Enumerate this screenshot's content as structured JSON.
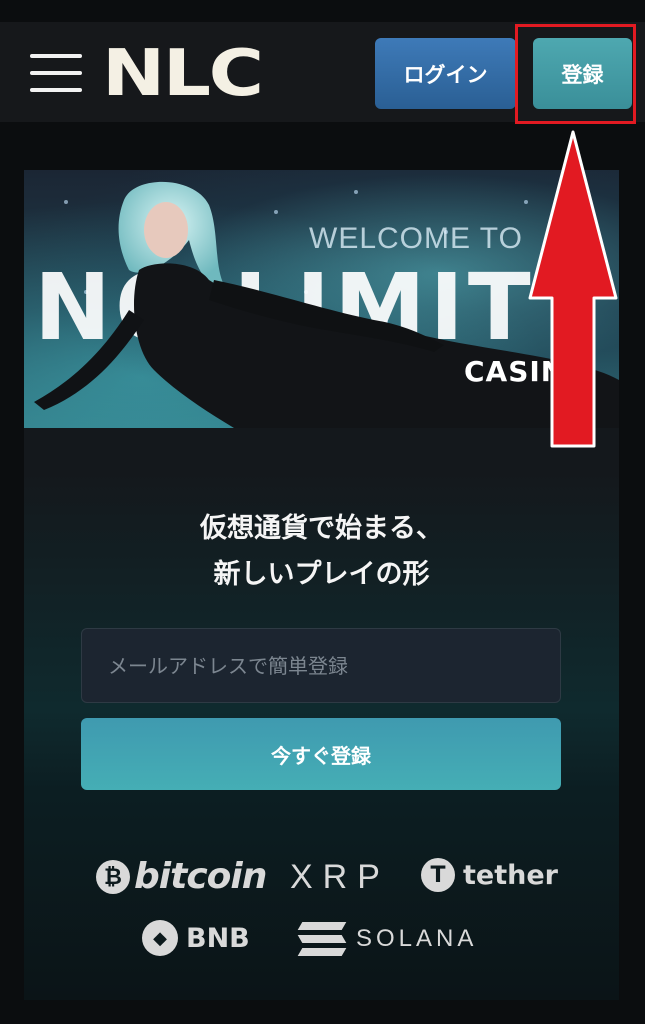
{
  "header": {
    "logo_text": "NLC",
    "login_label": "ログイン",
    "register_label": "登録"
  },
  "banner": {
    "welcome_text": "WELCOME TO",
    "brand_text": "NO LIMIT",
    "casino_text": "CASINO"
  },
  "main": {
    "tagline_line1": "仮想通貨で始まる、",
    "tagline_line2": "新しいプレイの形",
    "email_placeholder": "メールアドレスで簡単登録",
    "submit_label": "今すぐ登録"
  },
  "crypto": {
    "bitcoin": "bitcoin",
    "xrp": "XRP",
    "tether": "tether",
    "bnb": "BNB",
    "solana": "SOLANA"
  },
  "colors": {
    "annotation": "#e21a22",
    "login_button": "#2e679e",
    "register_button": "#45a0aa",
    "submit_button": "#43a6b3"
  },
  "icons": {
    "menu": "hamburger-menu-icon",
    "annotation": "red-arrow-up-icon"
  }
}
